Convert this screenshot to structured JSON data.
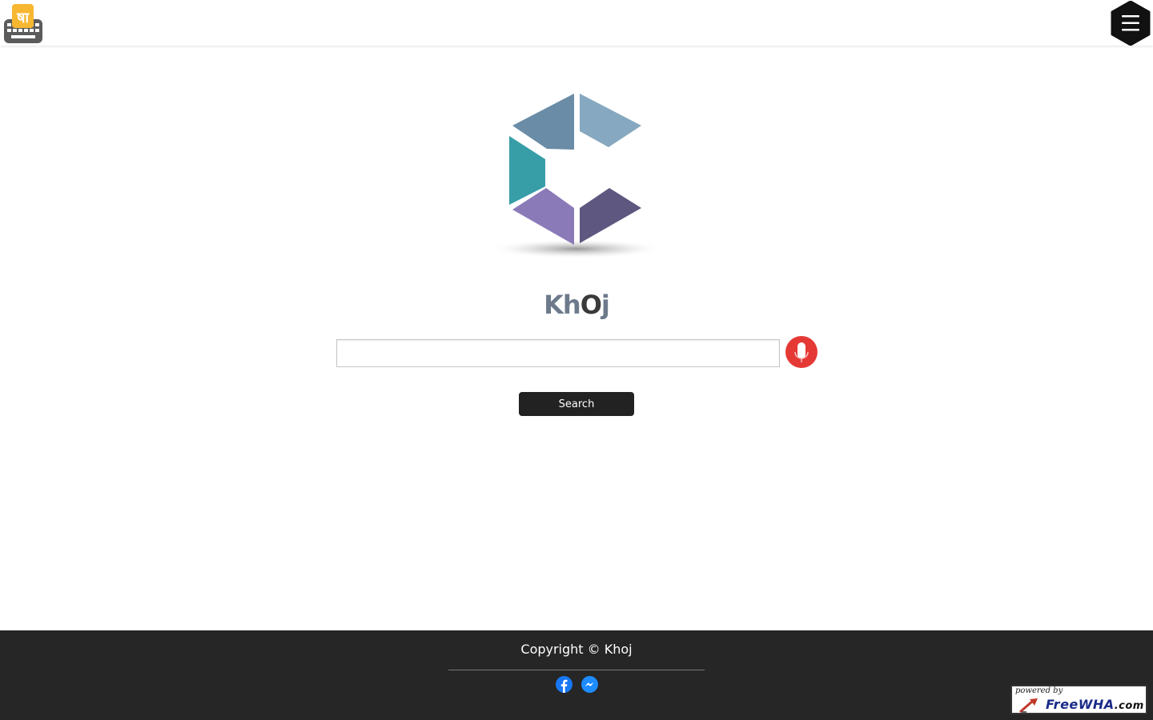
{
  "header": {
    "keyboard_logo_glyph": "षा",
    "keyboard_icon": "keyboard-icon",
    "menu_icon": "hamburger-menu-icon"
  },
  "brand": {
    "name_kh": "Kh",
    "name_o": "O",
    "name_j": "j"
  },
  "search": {
    "input_value": "",
    "placeholder": "",
    "button_label": "Search",
    "mic_icon": "microphone-icon"
  },
  "footer": {
    "copyright": "Copyright © Khoj",
    "social": [
      "facebook-icon",
      "messenger-icon"
    ]
  },
  "badge": {
    "powered_by": "powered by",
    "brand": "FreeWHA",
    "suffix": ".com"
  },
  "colors": {
    "footer_bg": "#262626",
    "button_bg": "#222222",
    "mic_red": "#e53935",
    "logo_teal": "#379ea8",
    "logo_blue": "#6a8ca6",
    "logo_lightblue": "#86a8c0",
    "logo_purple": "#8b7ab8",
    "logo_darkpurple": "#5e5780",
    "keyboard_yellow": "#f7b731"
  }
}
